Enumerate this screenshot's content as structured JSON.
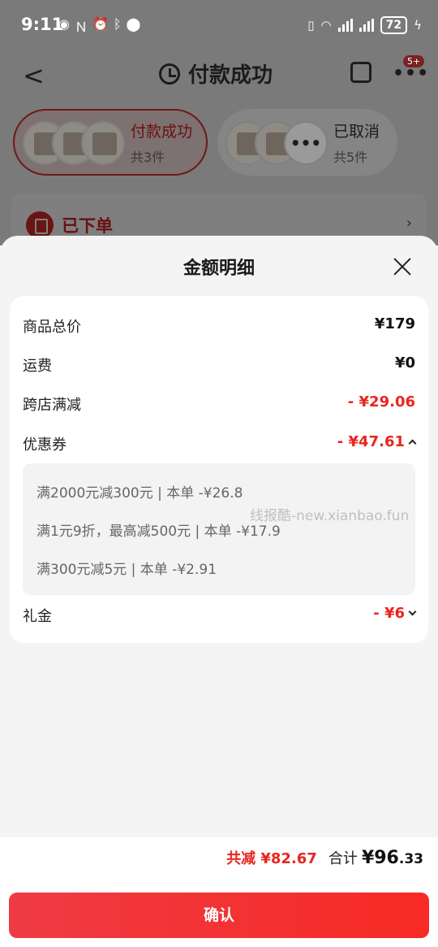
{
  "status_bar": {
    "time": "9:11",
    "battery": "72"
  },
  "background_page": {
    "nav_title": "付款成功",
    "badge": "5+",
    "order_tabs": [
      {
        "title": "付款成功",
        "count": "共3件"
      },
      {
        "title": "已取消",
        "count": "共5件"
      }
    ],
    "status_label": "已下单"
  },
  "sheet": {
    "title": "金额明细",
    "rows": {
      "total": {
        "label": "商品总价",
        "value": "¥179"
      },
      "shipping": {
        "label": "运费",
        "value": "¥0"
      },
      "cross_store": {
        "label": "跨店满减",
        "value": "- ¥29.06"
      },
      "coupon": {
        "label": "优惠券",
        "value": "- ¥47.61"
      },
      "gift": {
        "label": "礼金",
        "value": "- ¥6"
      }
    },
    "coupon_details": [
      "满2000元减300元 | 本单 -¥26.8",
      "满1元9折，最高减500元 | 本单 -¥17.9",
      "满300元减5元 | 本单 -¥2.91"
    ]
  },
  "watermark": "线报酷-new.xianbao.fun",
  "footer": {
    "saved": "共减 ¥82.67",
    "sum_label": "合计",
    "sum_int": "¥96",
    "sum_dec": ".33",
    "confirm_label": "确认"
  },
  "colors": {
    "accent": "#e8251f",
    "button_start": "#ef3b44",
    "button_end": "#f72a25",
    "overlay": "#7a7a7a"
  }
}
